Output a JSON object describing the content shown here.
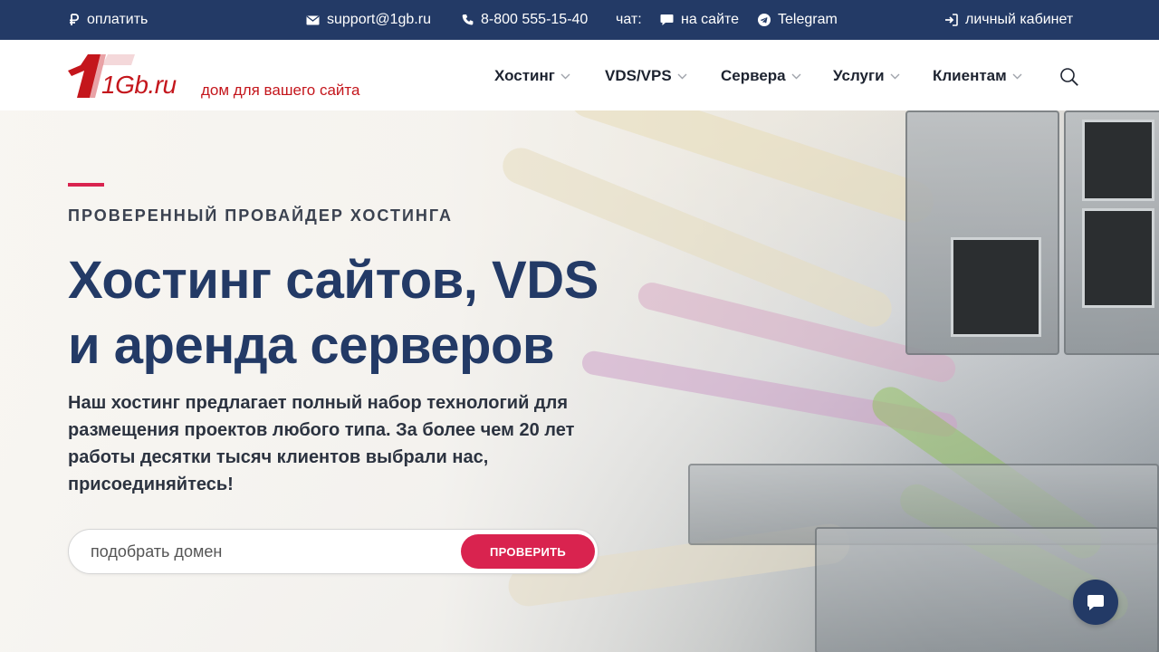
{
  "topbar": {
    "pay": {
      "icon": "ruble-icon",
      "label": "оплатить"
    },
    "email": {
      "icon": "mail-icon",
      "label": "support@1gb.ru"
    },
    "phone": {
      "icon": "phone-icon",
      "label": "8-800 555-15-40"
    },
    "chat_label": "чат:",
    "chat_site": {
      "icon": "chat-bubble-icon",
      "label": "на сайте"
    },
    "telegram": {
      "icon": "telegram-icon",
      "label": "Telegram"
    },
    "cabinet": {
      "icon": "login-icon",
      "label": "личный кабинет"
    }
  },
  "header": {
    "logo_text": "1Gb.ru",
    "tagline": "дом для вашего сайта",
    "nav": [
      {
        "label": "Хостинг"
      },
      {
        "label": "VDS/VPS"
      },
      {
        "label": "Сервера"
      },
      {
        "label": "Услуги"
      },
      {
        "label": "Клиентам"
      }
    ],
    "search_icon": "search-icon"
  },
  "hero": {
    "eyebrow": "ПРОВЕРЕННЫЙ ПРОВАЙДЕР ХОСТИНГА",
    "headline_line1": "Хостинг сайтов, VDS",
    "headline_line2": "и аренда серверов",
    "description": "Наш хостинг предлагает полный набор технологий для размещения проектов любого типа. За более чем 20 лет работы десятки тысяч клиентов выбрали нас, присоединяйтесь!",
    "domain_placeholder": "подобрать домен",
    "check_button": "ПРОВЕРИТЬ"
  },
  "chat_widget_icon": "chat-icon",
  "colors": {
    "navy": "#233a66",
    "accent": "#d9234f",
    "logo_red": "#c4161c"
  }
}
